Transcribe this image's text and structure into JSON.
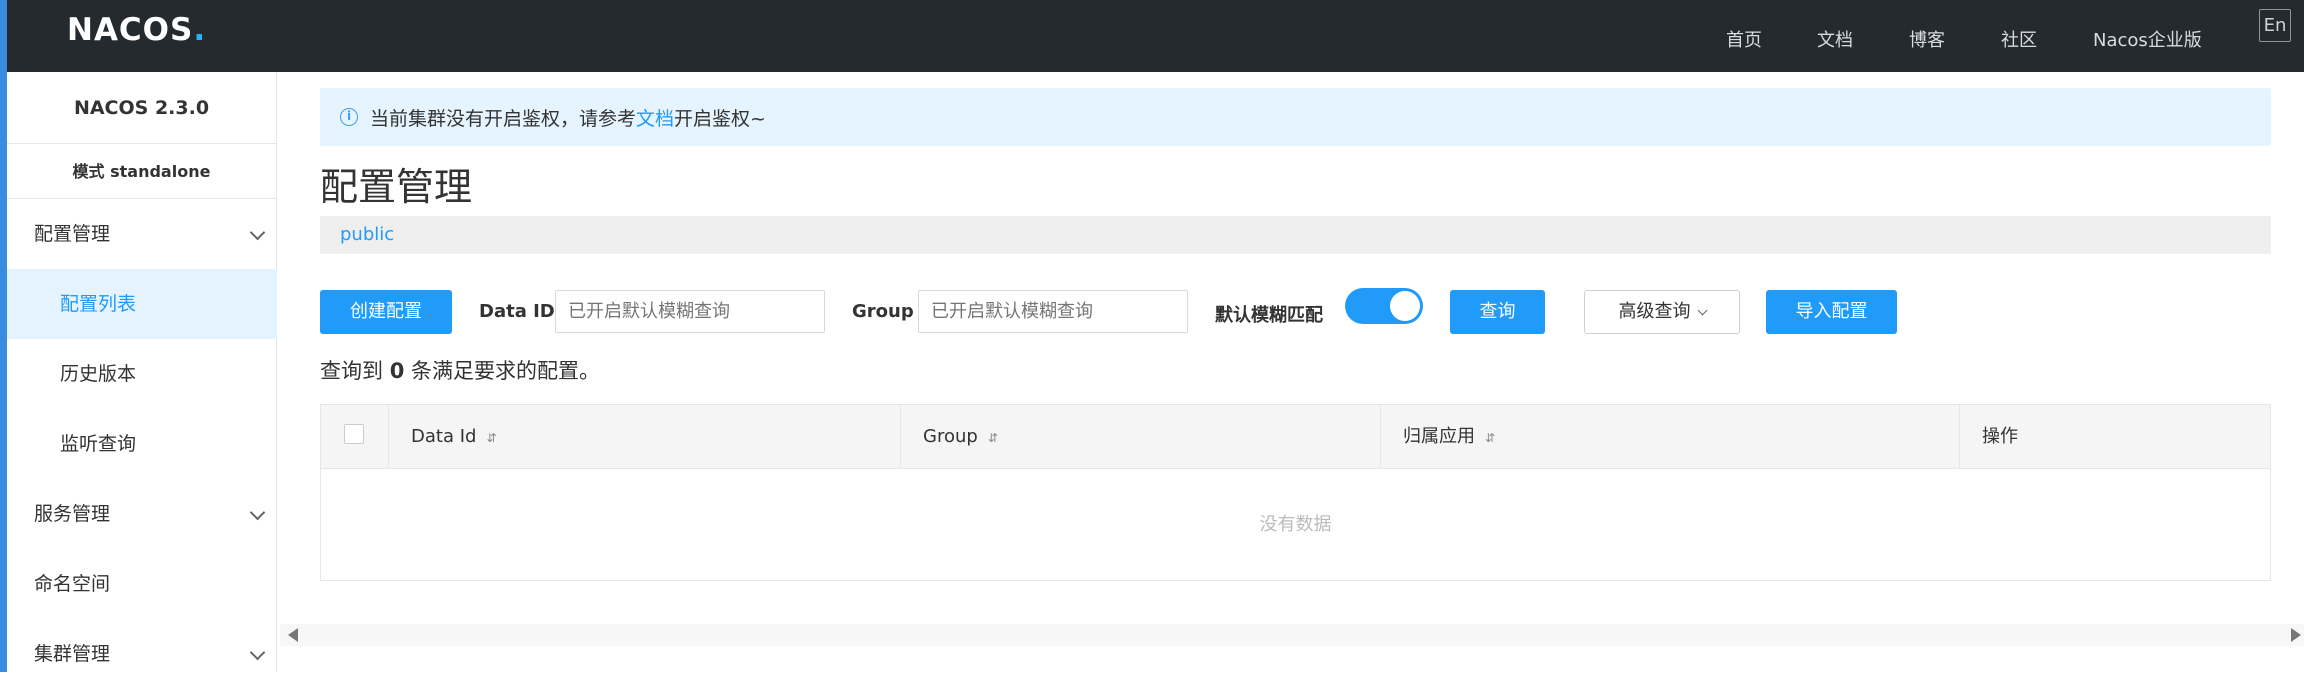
{
  "header": {
    "logo_main": "NACOS",
    "logo_dot": ".",
    "nav": [
      "首页",
      "文档",
      "博客",
      "社区",
      "Nacos企业版"
    ],
    "lang_button": "En"
  },
  "sidebar": {
    "version": "NACOS 2.3.0",
    "mode": "模式 standalone",
    "items": [
      {
        "label": "配置管理",
        "expandable": true
      },
      {
        "label": "配置列表",
        "active": true
      },
      {
        "label": "历史版本"
      },
      {
        "label": "监听查询"
      },
      {
        "label": "服务管理",
        "expandable": true
      },
      {
        "label": "命名空间"
      },
      {
        "label": "集群管理",
        "expandable": true
      }
    ]
  },
  "notice": {
    "text_before": "当前集群没有开启鉴权，请参考",
    "link": "文档",
    "text_after": "开启鉴权~"
  },
  "page": {
    "title": "配置管理",
    "namespace": "public"
  },
  "toolbar": {
    "create_button": "创建配置",
    "dataid_label": "Data ID",
    "dataid_placeholder": "已开启默认模糊查询",
    "group_label": "Group",
    "group_placeholder": "已开启默认模糊查询",
    "fuzzy_label": "默认模糊匹配",
    "fuzzy_on": true,
    "query_button": "查询",
    "advanced_button": "高级查询",
    "import_button": "导入配置"
  },
  "result": {
    "prefix": "查询到",
    "count": "0",
    "suffix": "条满足要求的配置。"
  },
  "table": {
    "columns": [
      "Data Id",
      "Group",
      "归属应用",
      "操作"
    ],
    "empty_text": "没有数据"
  },
  "colors": {
    "accent": "#209bfa",
    "header_bg": "#252a2f",
    "notice_bg": "#e5f4ff"
  }
}
